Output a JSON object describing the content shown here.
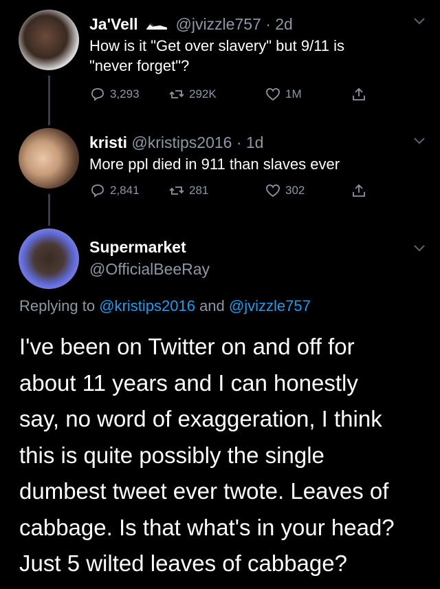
{
  "tweets": [
    {
      "name": "Ja'Vell",
      "handle": "@jvizzle757",
      "time": "· 2d",
      "text_line1": "How is it \"Get over slavery\" but 9/11 is",
      "text_line2": "\"never forget\"?",
      "replies": "3,293",
      "retweets": "292K",
      "likes": "1M"
    },
    {
      "name": "kristi",
      "handle": "@kristips2016",
      "time": "· 1d",
      "text_line1": "More ppl died in 911 than slaves ever",
      "replies": "2,841",
      "retweets": "281",
      "likes": "302"
    }
  ],
  "main": {
    "name": "Supermarket",
    "handle": "@OfficialBeeRay",
    "replying_prefix": "Replying to",
    "replying_to_1": "@kristips2016",
    "replying_and": "and",
    "replying_to_2": "@jvizzle757",
    "text_lines": [
      "I've been on Twitter on and off for",
      "about 11 years and I can honestly",
      "say, no word of exaggeration, I think",
      "this is quite possibly the single",
      "dumbest tweet ever twote. Leaves of",
      "cabbage. Is that what's in your head?",
      "Just 5 wilted leaves of cabbage?"
    ]
  },
  "colors": {
    "background": "#000000",
    "text": "#ffffff",
    "secondary": "#8b98a5",
    "link": "#1d9bf0"
  },
  "icons": [
    "reply-icon",
    "retweet-icon",
    "like-icon",
    "share-icon",
    "chevron-down-icon"
  ]
}
